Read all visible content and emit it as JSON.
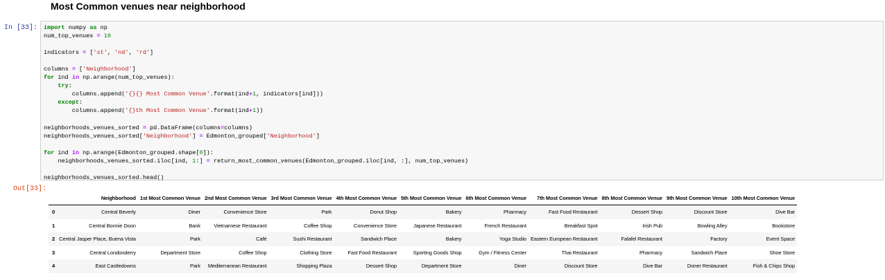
{
  "heading": "Most Common venues near neighborhood",
  "cell": {
    "in_prompt": "In [33]:",
    "out_prompt": "Out[33]:"
  },
  "table": {
    "columns": [
      "",
      "Neighborhood",
      "1st Most Common Venue",
      "2nd Most Common Venue",
      "3rd Most Common Venue",
      "4th Most Common Venue",
      "5th Most Common Venue",
      "6th Most Common Venue",
      "7th Most Common Venue",
      "8th Most Common Venue",
      "9th Most Common Venue",
      "10th Most Common Venue"
    ],
    "rows": [
      [
        "0",
        "Central Beverly",
        "Diner",
        "Convenience Store",
        "Park",
        "Donut Shop",
        "Bakery",
        "Pharmacy",
        "Fast Food Restaurant",
        "Dessert Shop",
        "Discount Store",
        "Dive Bar"
      ],
      [
        "1",
        "Central Bonnie Doon",
        "Bank",
        "Vietnamese Restaurant",
        "Coffee Shop",
        "Convenience Store",
        "Japanese Restaurant",
        "French Restaurant",
        "Breakfast Spot",
        "Irish Pub",
        "Bowling Alley",
        "Bookstore"
      ],
      [
        "2",
        "Central Jasper Place, Buena Vista",
        "Park",
        "Café",
        "Sushi Restaurant",
        "Sandwich Place",
        "Bakery",
        "Yoga Studio",
        "Eastern European Restaurant",
        "Falafel Restaurant",
        "Factory",
        "Event Space"
      ],
      [
        "3",
        "Central Londonderry",
        "Department Store",
        "Coffee Shop",
        "Clothing Store",
        "Fast Food Restaurant",
        "Sporting Goods Shop",
        "Gym / Fitness Center",
        "Thai Restaurant",
        "Pharmacy",
        "Sandwich Place",
        "Shoe Store"
      ],
      [
        "4",
        "East Castledowns",
        "Park",
        "Mediterranean Restaurant",
        "Shopping Plaza",
        "Dessert Shop",
        "Department Store",
        "Diner",
        "Discount Store",
        "Dive Bar",
        "Doner Restaurant",
        "Fish & Chips Shop"
      ]
    ]
  }
}
